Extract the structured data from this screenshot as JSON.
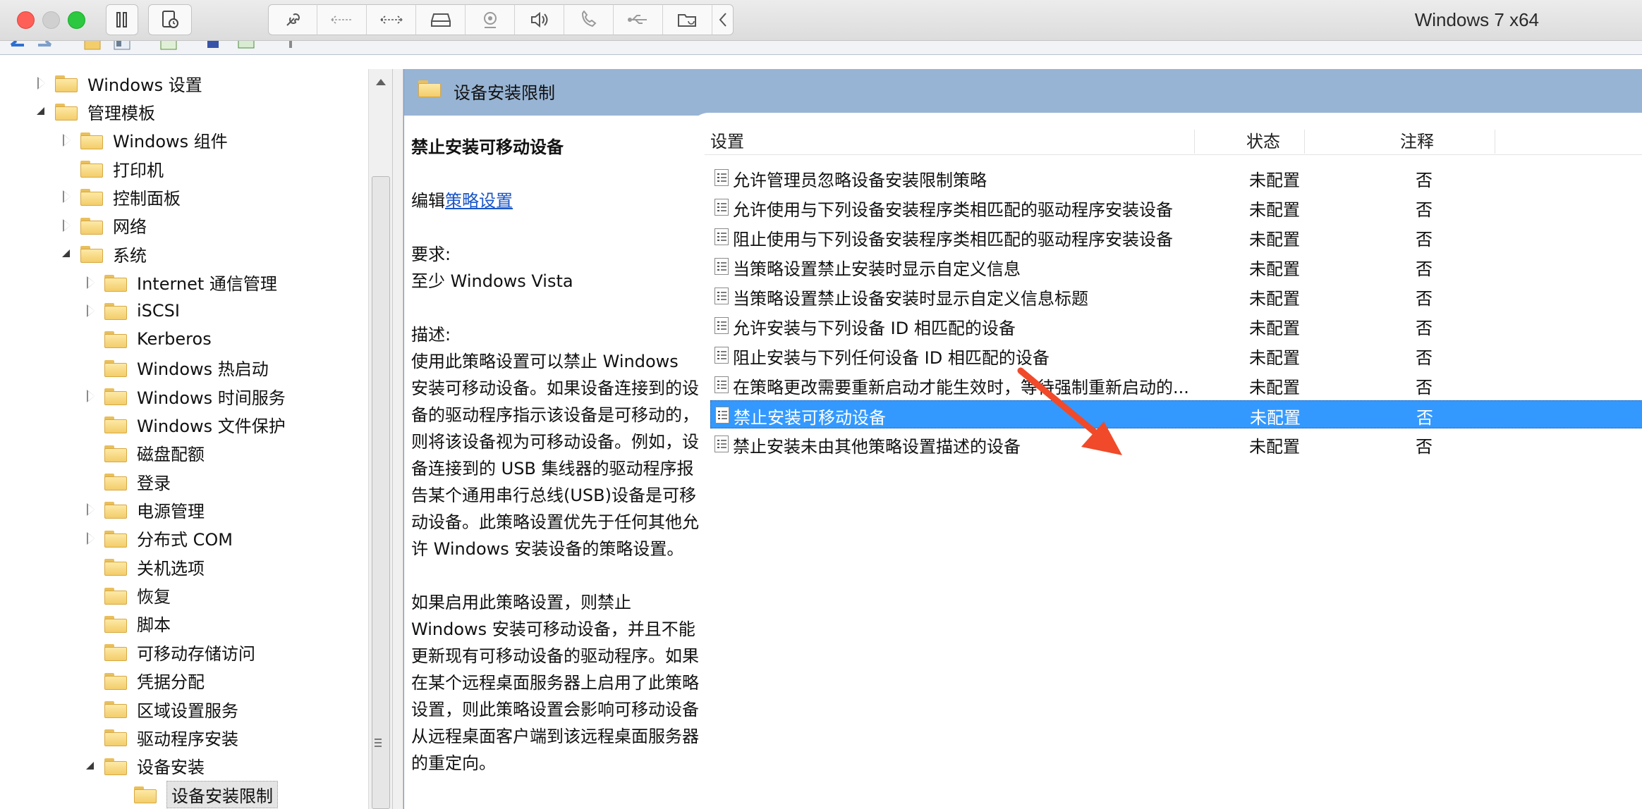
{
  "vm": {
    "title": "Windows 7 x64",
    "toolbar_icons": [
      "pause-icon",
      "snapshot-icon",
      "settings-wrench-icon",
      "network-back-icon",
      "network-forward-icon",
      "hard-disk-icon",
      "camera-icon",
      "speaker-icon",
      "microphone-icon",
      "usb-icon",
      "shared-folder-icon",
      "collapse-chevron-icon"
    ]
  },
  "tree": {
    "items": [
      {
        "label": "Windows 设置",
        "state": "collapsed",
        "level": 1
      },
      {
        "label": "管理模板",
        "state": "expanded",
        "level": 1
      },
      {
        "label": "Windows 组件",
        "state": "collapsed",
        "level": 2
      },
      {
        "label": "打印机",
        "state": "none",
        "level": 2
      },
      {
        "label": "控制面板",
        "state": "collapsed",
        "level": 2
      },
      {
        "label": "网络",
        "state": "collapsed",
        "level": 2
      },
      {
        "label": "系统",
        "state": "expanded",
        "level": 2
      },
      {
        "label": "Internet 通信管理",
        "state": "collapsed",
        "level": 3
      },
      {
        "label": "iSCSI",
        "state": "collapsed",
        "level": 3
      },
      {
        "label": "Kerberos",
        "state": "none",
        "level": 3
      },
      {
        "label": "Windows 热启动",
        "state": "none",
        "level": 3
      },
      {
        "label": "Windows 时间服务",
        "state": "collapsed",
        "level": 3
      },
      {
        "label": "Windows 文件保护",
        "state": "none",
        "level": 3
      },
      {
        "label": "磁盘配额",
        "state": "none",
        "level": 3
      },
      {
        "label": "登录",
        "state": "none",
        "level": 3
      },
      {
        "label": "电源管理",
        "state": "collapsed",
        "level": 3
      },
      {
        "label": "分布式 COM",
        "state": "collapsed",
        "level": 3
      },
      {
        "label": "关机选项",
        "state": "none",
        "level": 3
      },
      {
        "label": "恢复",
        "state": "none",
        "level": 3
      },
      {
        "label": "脚本",
        "state": "none",
        "level": 3
      },
      {
        "label": "可移动存储访问",
        "state": "none",
        "level": 3
      },
      {
        "label": "凭据分配",
        "state": "none",
        "level": 3
      },
      {
        "label": "区域设置服务",
        "state": "none",
        "level": 3
      },
      {
        "label": "驱动程序安装",
        "state": "none",
        "level": 3
      },
      {
        "label": "设备安装",
        "state": "expanded",
        "level": 3
      },
      {
        "label": "设备安装限制",
        "state": "selected",
        "level": 4
      }
    ]
  },
  "pane": {
    "title": "设备安装限制"
  },
  "description": {
    "title": "禁止安装可移动设备",
    "edit_prefix": "编辑",
    "edit_link": "策略设置",
    "requirements_label": "要求:",
    "requirements_value": "至少 Windows Vista",
    "description_label": "描述:",
    "paragraph1": "使用此策略设置可以禁止 Windows 安装可移动设备。如果设备连接到的设备的驱动程序指示该设备是可移动的，则将该设备视为可移动设备。例如，设备连接到的 USB 集线器的驱动程序报告某个通用串行总线(USB)设备是可移动设备。此策略设置优先于任何其他允许 Windows 安装设备的策略设置。",
    "paragraph2": "如果启用此策略设置，则禁止 Windows 安装可移动设备，并且不能更新现有可移动设备的驱动程序。如果在某个远程桌面服务器上启用了此策略设置，则此策略设置会影响可移动设备从远程桌面客户端到该远程桌面服务器的重定向。"
  },
  "list": {
    "columns": [
      "设置",
      "状态",
      "注释"
    ],
    "rows": [
      {
        "name": "允许管理员忽略设备安装限制策略",
        "state": "未配置",
        "note": "否"
      },
      {
        "name": "允许使用与下列设备安装程序类相匹配的驱动程序安装设备",
        "state": "未配置",
        "note": "否"
      },
      {
        "name": "阻止使用与下列设备安装程序类相匹配的驱动程序安装设备",
        "state": "未配置",
        "note": "否"
      },
      {
        "name": "当策略设置禁止安装时显示自定义信息",
        "state": "未配置",
        "note": "否"
      },
      {
        "name": "当策略设置禁止设备安装时显示自定义信息标题",
        "state": "未配置",
        "note": "否"
      },
      {
        "name": "允许安装与下列设备 ID 相匹配的设备",
        "state": "未配置",
        "note": "否"
      },
      {
        "name": "阻止安装与下列任何设备 ID 相匹配的设备",
        "state": "未配置",
        "note": "否"
      },
      {
        "name": "在策略更改需要重新启动才能生效时，等待强制重新启动的...",
        "state": "未配置",
        "note": "否"
      },
      {
        "name": "禁止安装可移动设备",
        "state": "未配置",
        "note": "否",
        "selected": true
      },
      {
        "name": "禁止安装未由其他策略设置描述的设备",
        "state": "未配置",
        "note": "否"
      }
    ]
  },
  "colors": {
    "header_bg": "#98b4d4",
    "selection": "#3399ff",
    "annotation_arrow": "#f04a2a",
    "link": "#1a55c8"
  }
}
